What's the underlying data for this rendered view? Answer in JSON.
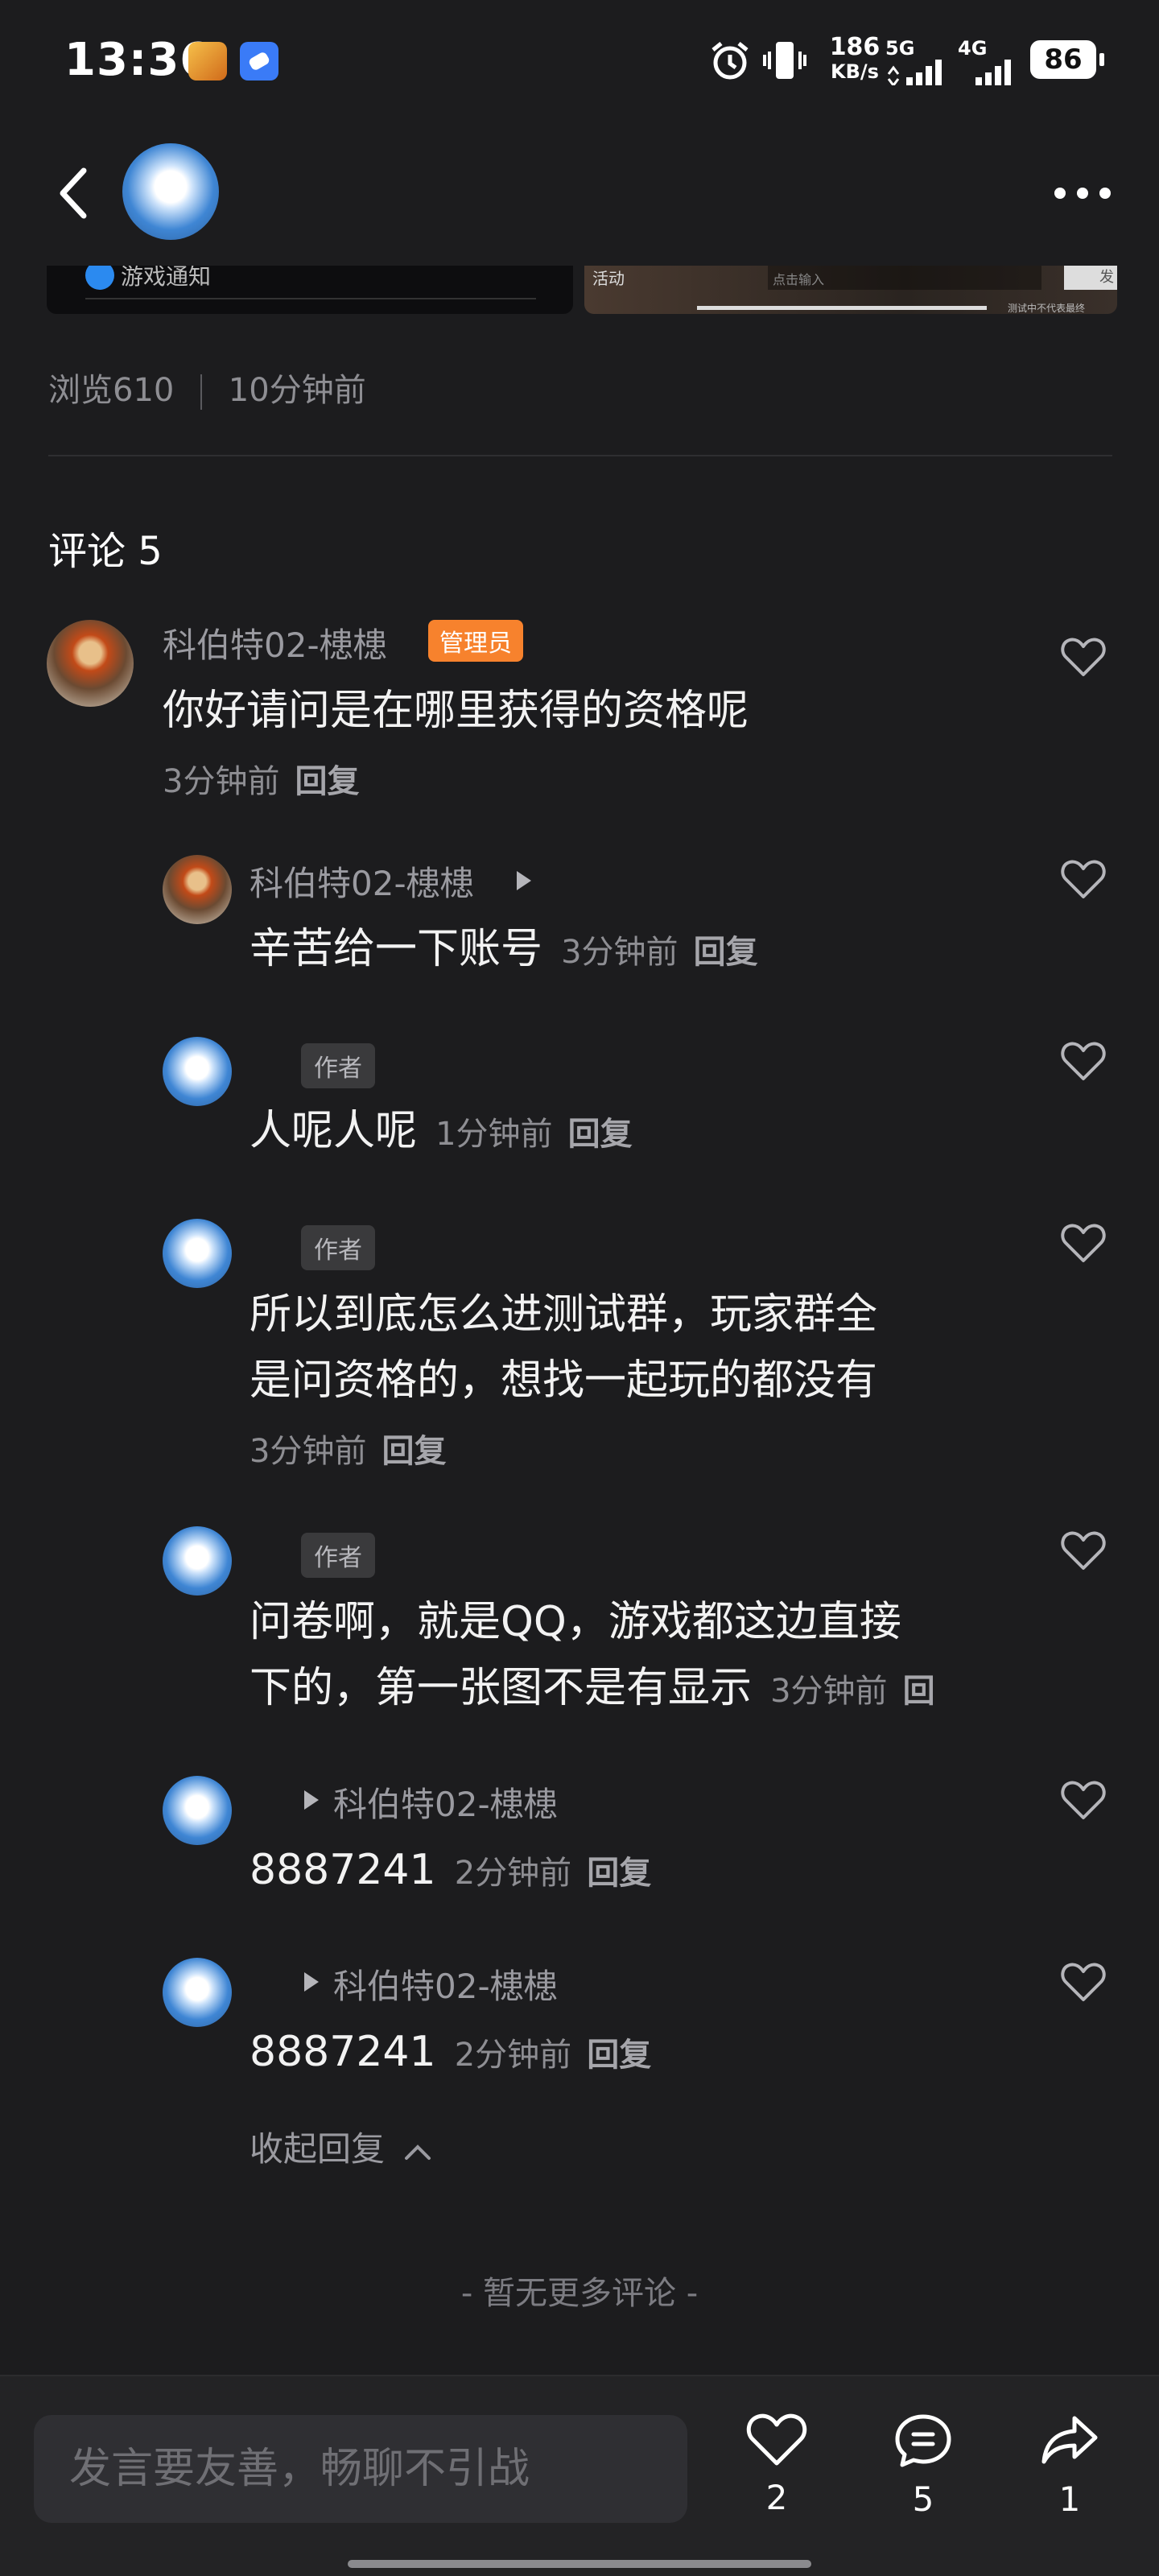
{
  "status_bar": {
    "time": "13:36",
    "net_speed_value": "186",
    "net_speed_unit": "KB/s",
    "sig1": "5G",
    "sig2": "4G",
    "battery": "86"
  },
  "post_strip": {
    "left_text": "游戏通知",
    "right_label": "活动",
    "input_placeholder": "点击输入",
    "send_label": "发",
    "tiny_caption": "测试中不代表最终"
  },
  "meta": {
    "views": "浏览610",
    "time": "10分钟前"
  },
  "comments": {
    "title": "评论 5",
    "main": {
      "name": "科伯特02-槵槵",
      "badge": "管理员",
      "text": "你好请问是在哪里获得的资格呢",
      "time": "3分钟前",
      "reply": "回复"
    },
    "replies": [
      {
        "name": "科伯特02-槵槵",
        "text": "辛苦给一下账号",
        "time": "3分钟前",
        "reply": "回复"
      },
      {
        "badge": "作者",
        "text": "人呢人呢",
        "time": "1分钟前",
        "reply": "回复"
      },
      {
        "badge": "作者",
        "line1": "所以到底怎么进测试群，玩家群全",
        "line2": "是问资格的，想找一起玩的都没有",
        "time": "3分钟前",
        "reply": "回复"
      },
      {
        "badge": "作者",
        "line1": "问卷啊，就是QQ，游戏都这边直接",
        "line2": "下的，第一张图不是有显示",
        "time": "3分钟前",
        "reply": "回"
      },
      {
        "target": "科伯特02-槵槵",
        "text": "8887241",
        "time": "2分钟前",
        "reply": "回复"
      },
      {
        "target": "科伯特02-槵槵",
        "text": "8887241",
        "time": "2分钟前",
        "reply": "回复"
      }
    ],
    "collapse_label": "收起回复",
    "no_more": "- 暂无更多评论 -"
  },
  "bottom_bar": {
    "placeholder": "发言要友善，畅聊不引战",
    "like_count": "2",
    "comment_count": "5",
    "share_count": "1"
  },
  "colors": {
    "background": "#1c1c1e",
    "admin_badge": "#f7822d",
    "author_badge": "#3a3a3c"
  }
}
